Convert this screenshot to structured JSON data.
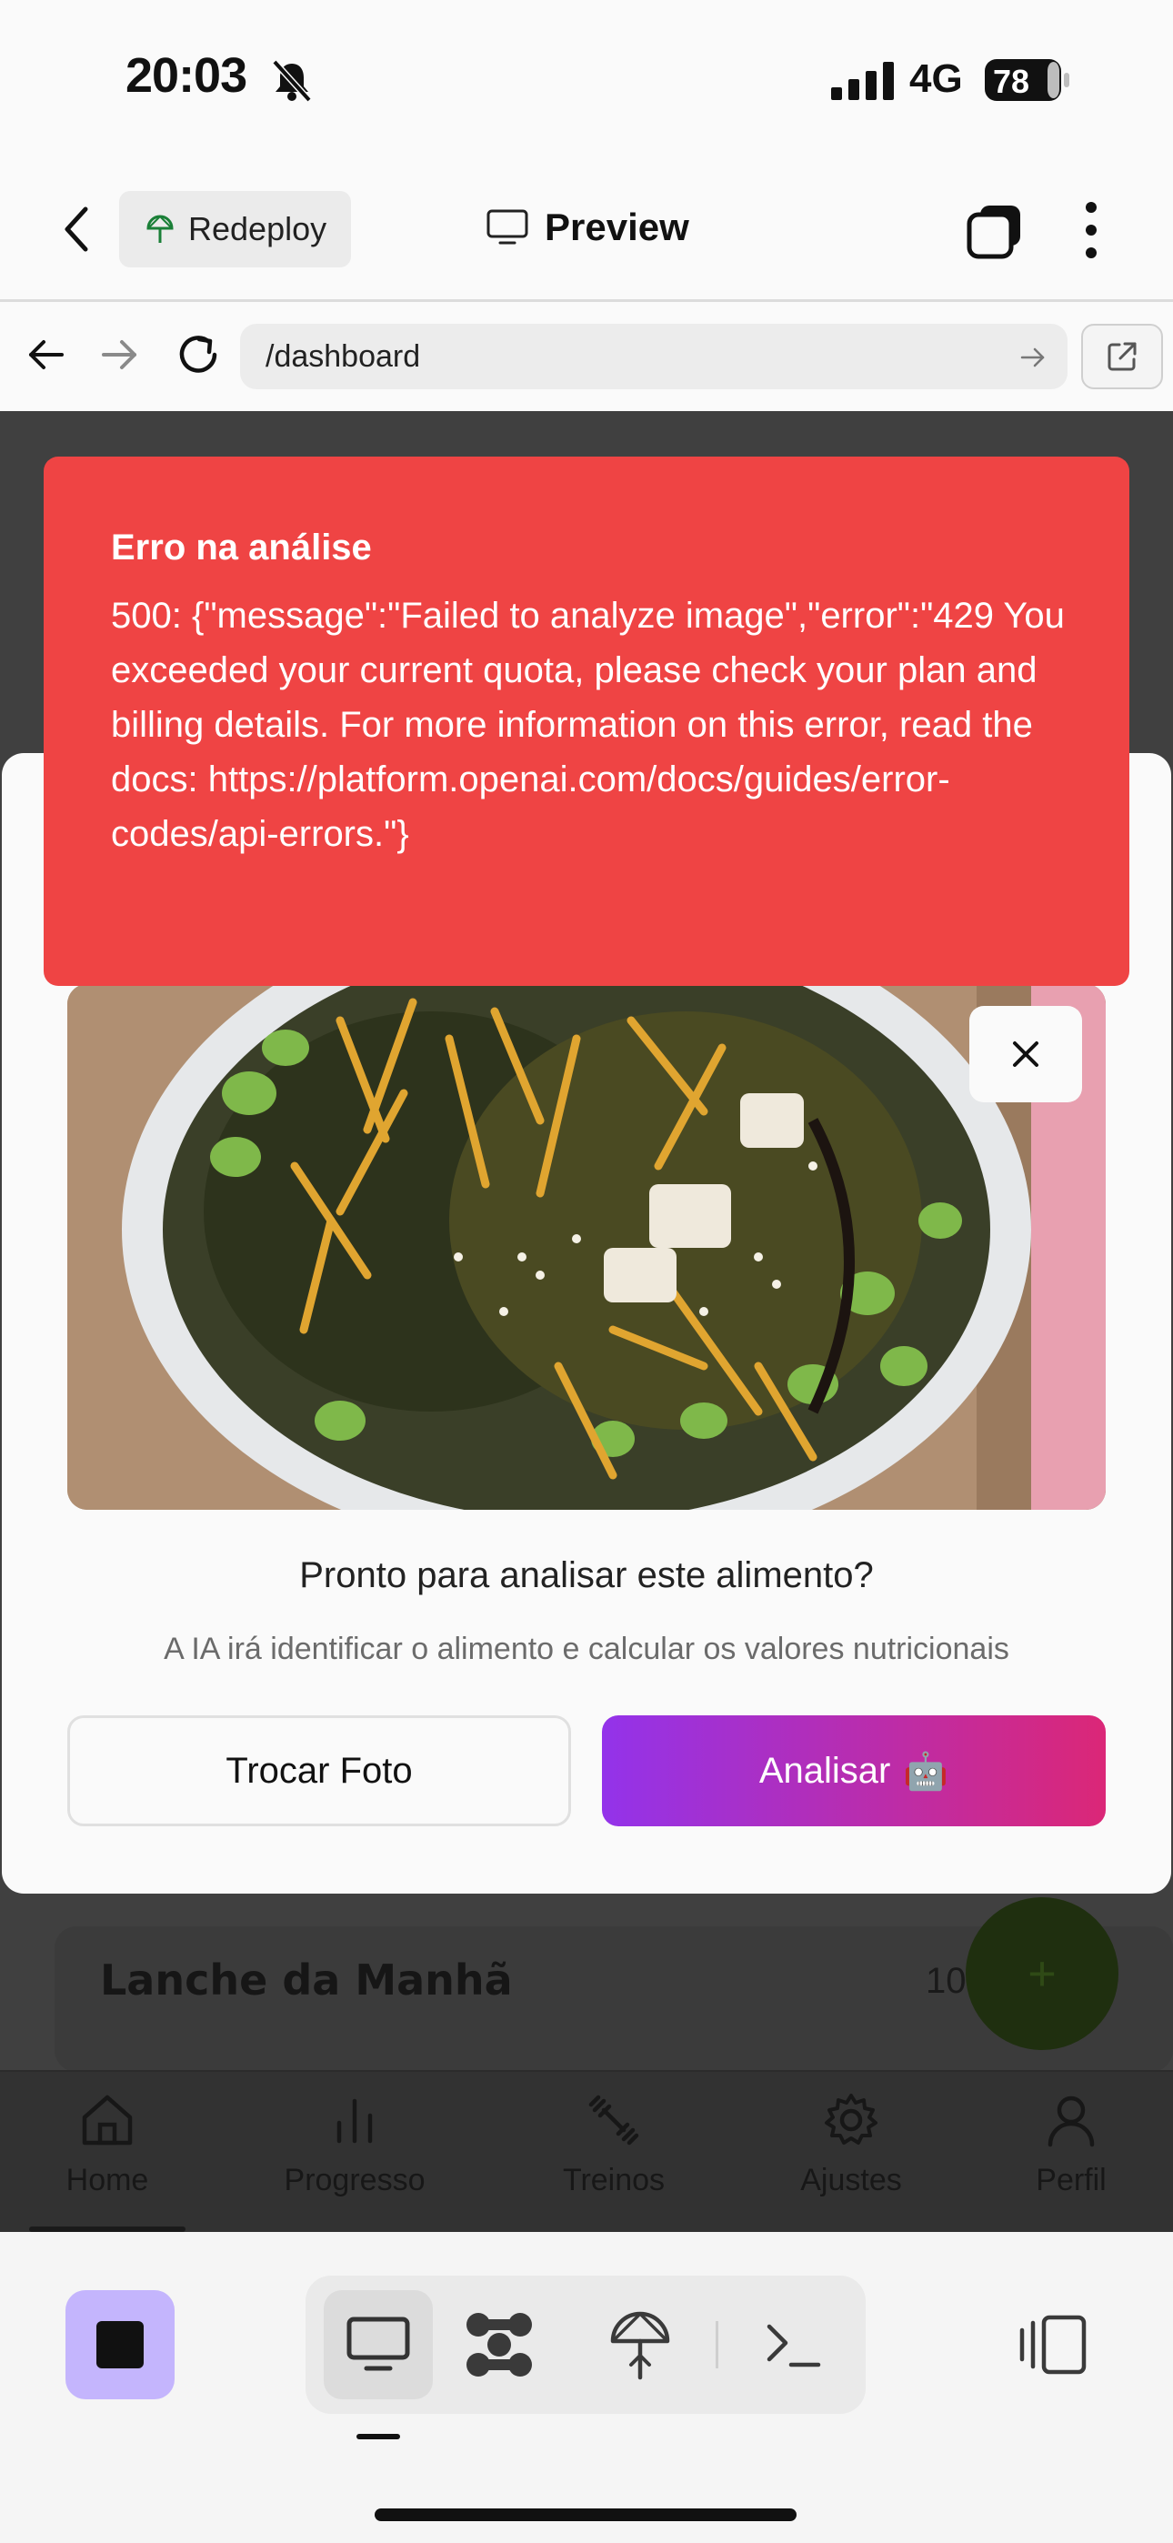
{
  "status_bar": {
    "time": "20:03",
    "network": "4G",
    "battery": "78"
  },
  "app_bar": {
    "redeploy_label": "Redeploy",
    "preview_label": "Preview"
  },
  "browser": {
    "url": "/dashboard"
  },
  "error_toast": {
    "title": "Erro na análise",
    "message": "500: {\"message\":\"Failed to analyze image\",\"error\":\"429 You exceeded your current quota, please check your plan and billing details. For more information on this error, read the docs: https://platform.openai.com/docs/guides/error-codes/api-errors.\"}"
  },
  "modal": {
    "question": "Pronto para analisar este alimento?",
    "hint": "A IA irá identificar o alimento e calcular os valores nutricionais",
    "change_photo_label": "Trocar Foto",
    "analyze_label": "Analisar",
    "analyze_emoji": "🤖"
  },
  "background_page": {
    "meal_title": "Lanche da Manhã",
    "meal_value": "100",
    "fab_label": "+",
    "nav": [
      {
        "label": "Home",
        "icon": "home-icon",
        "active": true
      },
      {
        "label": "Progresso",
        "icon": "bar-chart-icon",
        "active": false
      },
      {
        "label": "Treinos",
        "icon": "dumbbell-icon",
        "active": false
      },
      {
        "label": "Ajustes",
        "icon": "gear-icon",
        "active": false
      },
      {
        "label": "Perfil",
        "icon": "user-icon",
        "active": false
      }
    ]
  },
  "toolbar": {
    "active_mode": "desktop"
  },
  "colors": {
    "error": "#ef4444",
    "analyze_gradient_start": "#9333ea",
    "analyze_gradient_end": "#db2777",
    "stop_button": "#c4b5fd"
  }
}
